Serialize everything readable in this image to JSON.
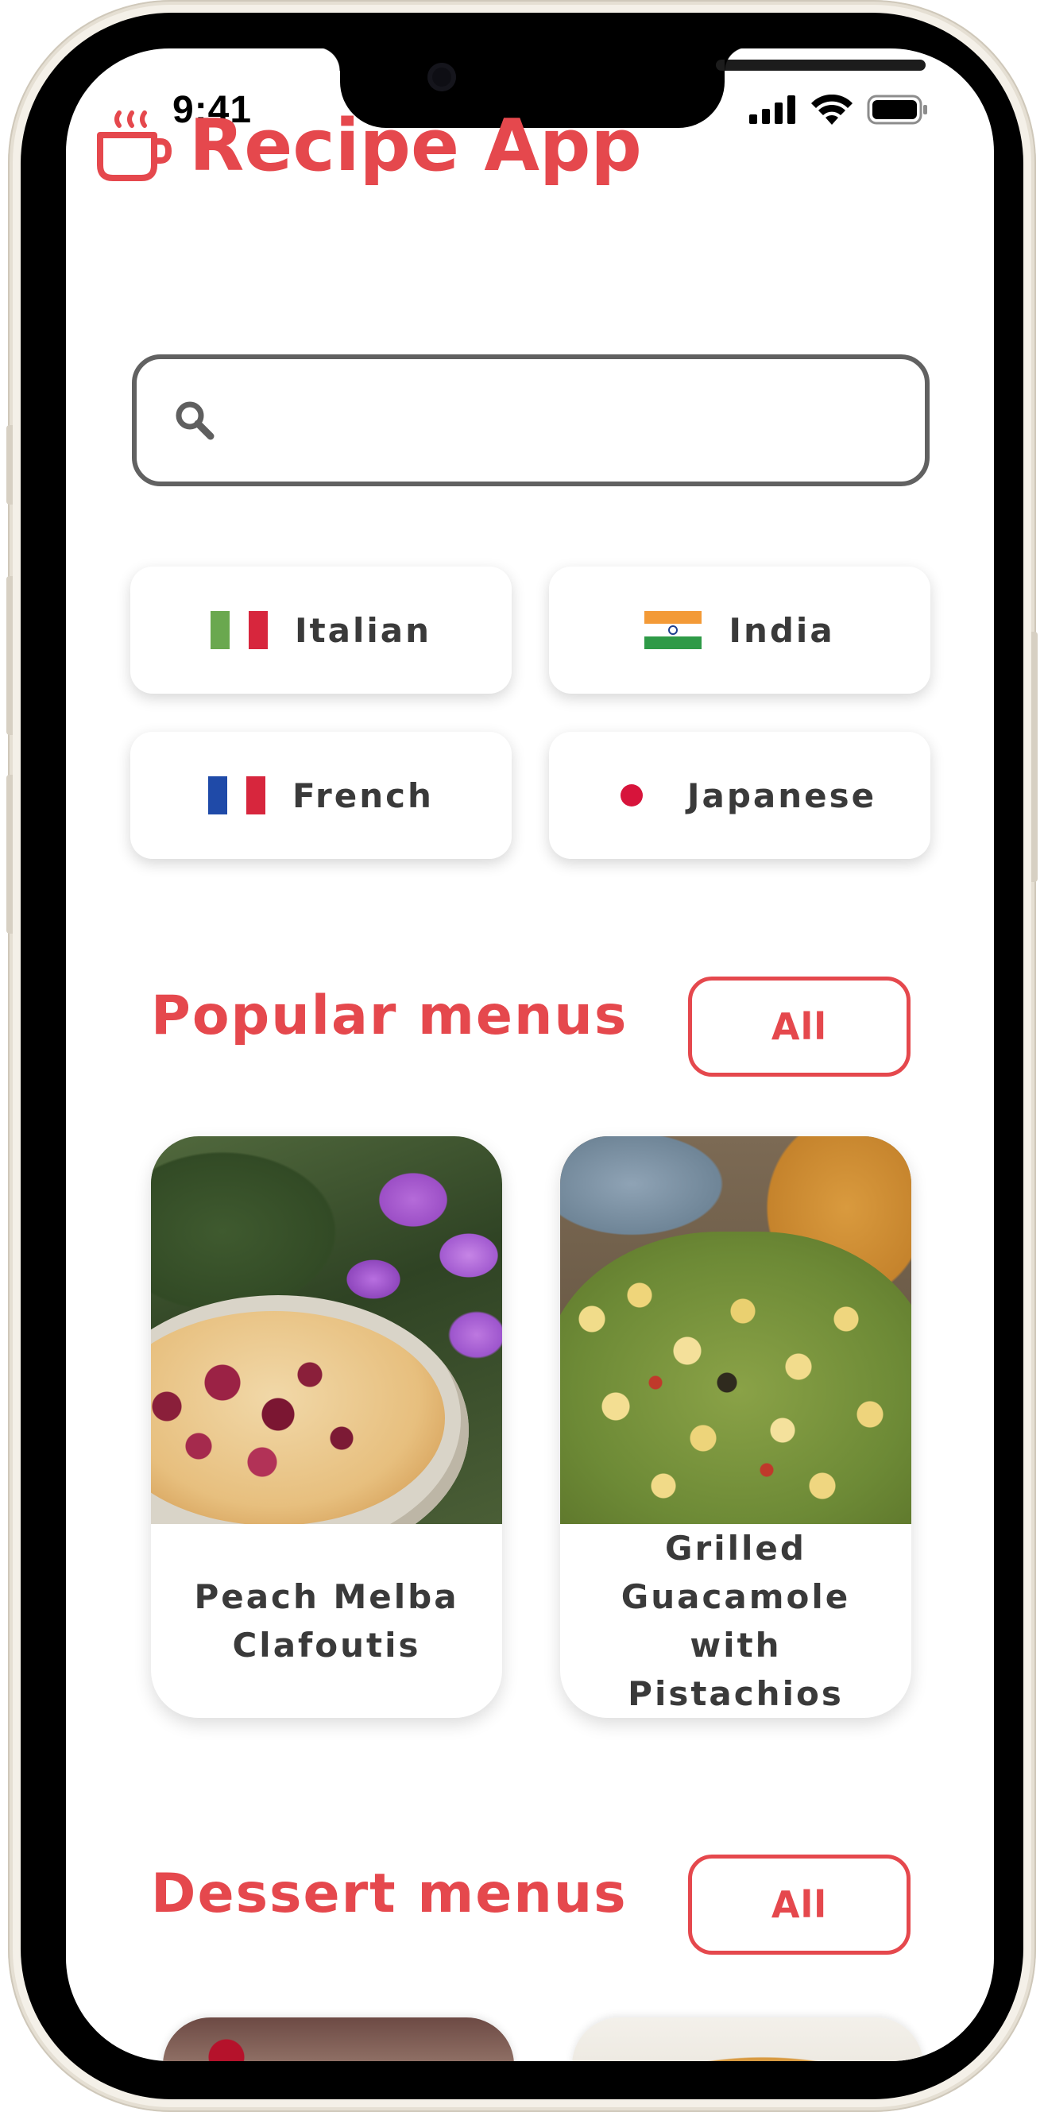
{
  "status_bar": {
    "time": "9:41",
    "icons": [
      "signal-icon",
      "wifi-icon",
      "battery-icon"
    ]
  },
  "header": {
    "logo_icon": "coffee-cup-icon",
    "title": "Recipe App"
  },
  "search": {
    "icon": "search-icon",
    "value": "",
    "placeholder": ""
  },
  "cuisines": [
    {
      "label": "Italian",
      "flag": "italy-flag-icon"
    },
    {
      "label": "India",
      "flag": "india-flag-icon"
    },
    {
      "label": "French",
      "flag": "france-flag-icon"
    },
    {
      "label": "Japanese",
      "flag": "japan-flag-icon"
    }
  ],
  "popular": {
    "title": "Popular menus",
    "all_label": "All",
    "cards": [
      {
        "title": "Peach Melba Clafoutis"
      },
      {
        "title": "Grilled Guacamole with Pistachios"
      }
    ]
  },
  "dessert": {
    "title": "Dessert menus",
    "all_label": "All"
  },
  "colors": {
    "accent": "#e5484d",
    "text_dark": "#3a3a3a",
    "search_border": "#616161"
  }
}
